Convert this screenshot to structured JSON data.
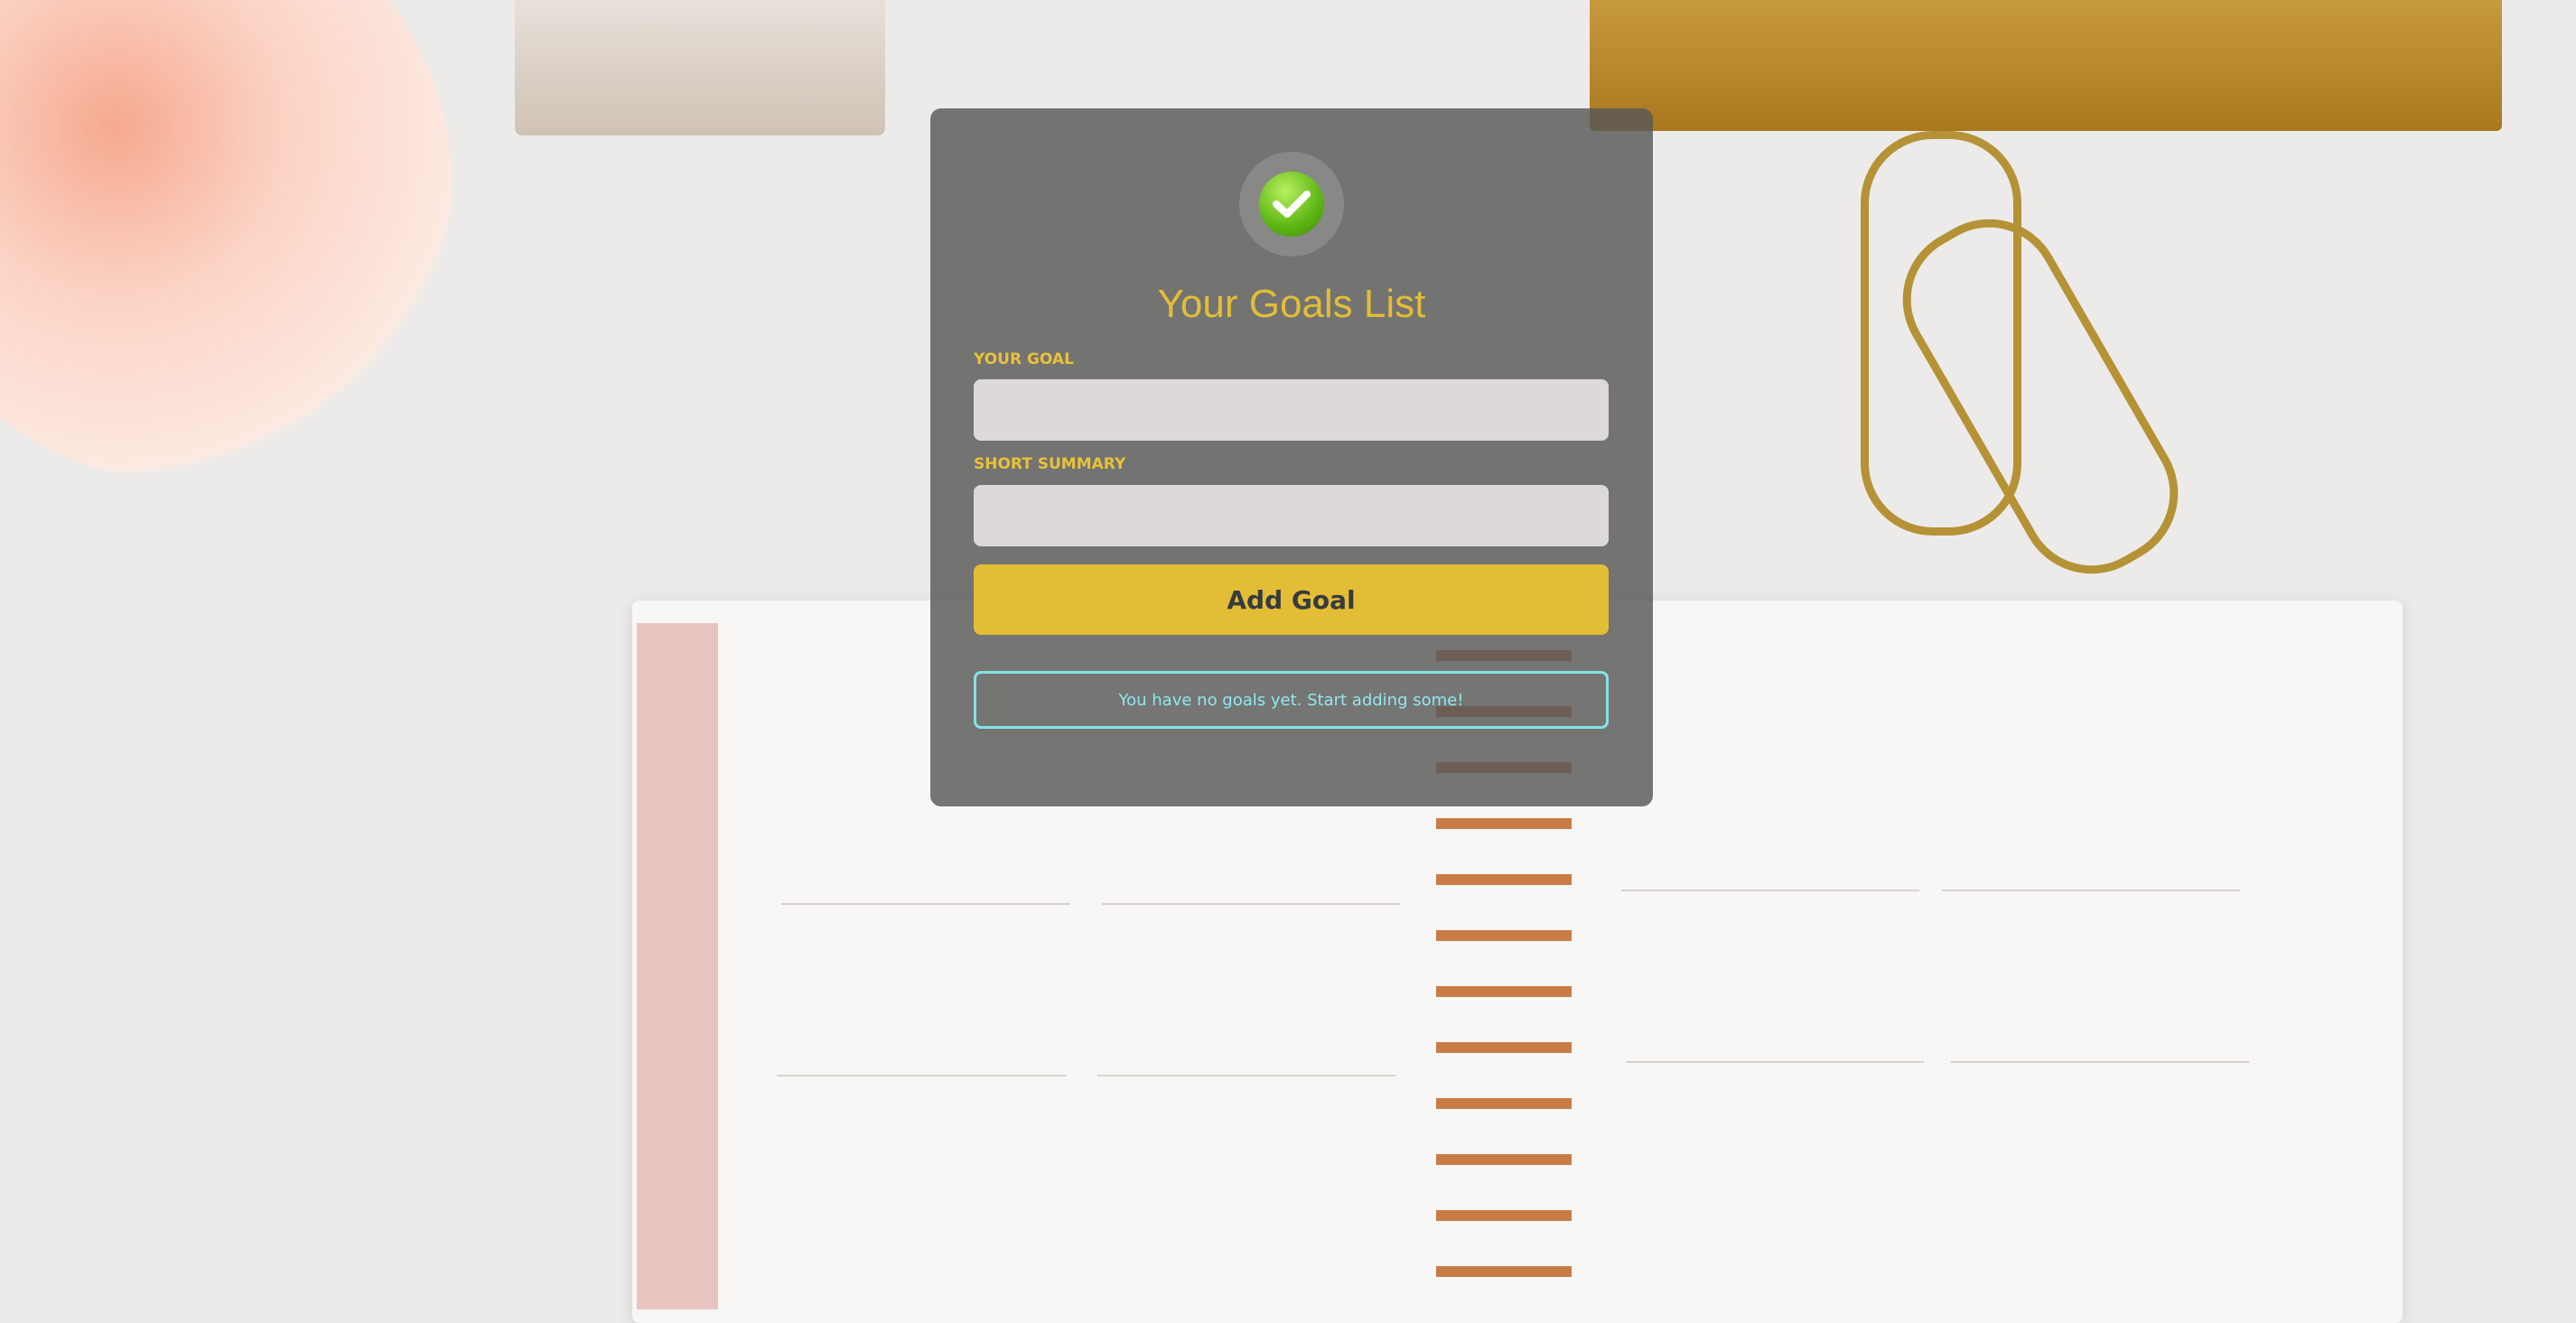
{
  "colors": {
    "accent": "#e3bd36",
    "button_text": "#363b3d",
    "info_border": "#84e3e8",
    "icon_green": "#5cb512"
  },
  "header": {
    "icon": "check-circle-icon",
    "title": "Your Goals List"
  },
  "form": {
    "goal_label": "YOUR GOAL",
    "goal_value": "",
    "summary_label": "SHORT SUMMARY",
    "summary_value": "",
    "submit_label": "Add Goal"
  },
  "goals_list": {
    "empty_message": "You have no goals yet. Start adding some!",
    "items": []
  }
}
